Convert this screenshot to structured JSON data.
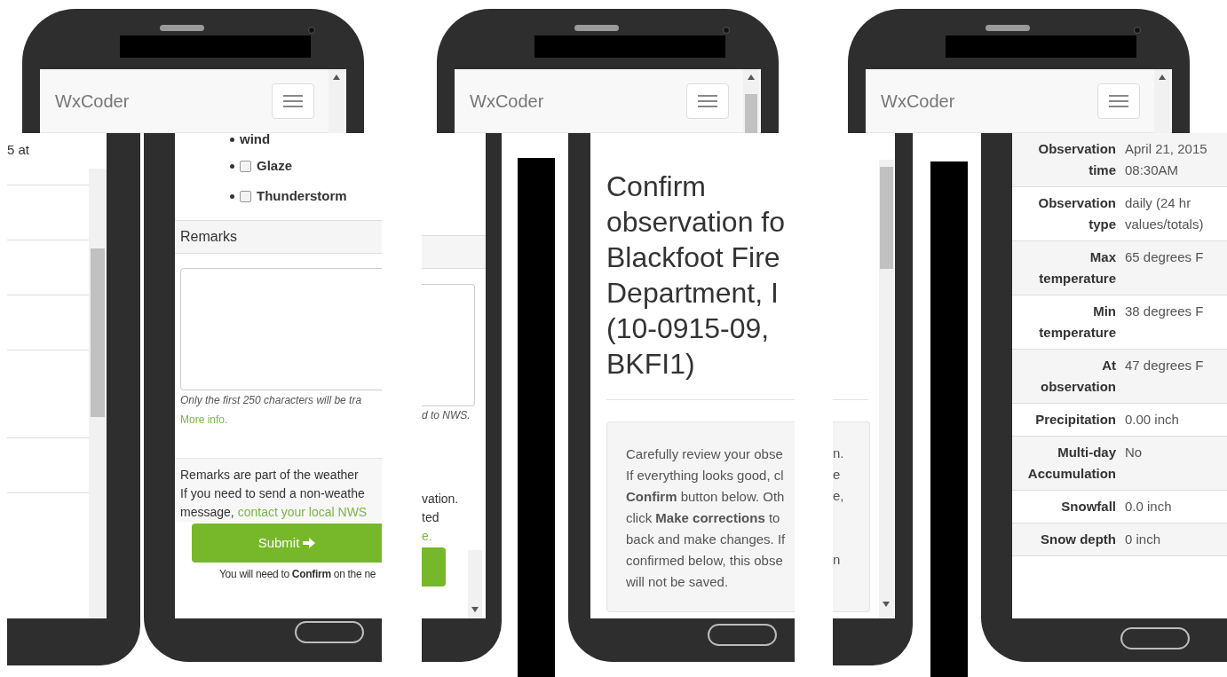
{
  "phones": [
    {
      "brand": "WxCoder"
    },
    {
      "brand": "WxCoder"
    },
    {
      "brand": "WxCoder"
    }
  ],
  "fragment_left": {
    "text": "5 at"
  },
  "remarks_screen": {
    "partial_item": "wind",
    "checkboxes": [
      {
        "label": "Glaze",
        "checked": false
      },
      {
        "label": "Thunderstorm",
        "checked": false
      }
    ],
    "section_title": "Remarks",
    "note": "Only the first 250 characters will be tra",
    "more_link": "More info.",
    "info_lines": [
      "Remarks are part of the weather",
      "If you need to send a non-weathe"
    ],
    "info_last": "message,",
    "info_link": "contact your local NWS",
    "submit": "Submit",
    "confirm_note": "You will need to **Confirm** on the ne"
  },
  "fragment_middle": {
    "lines": [
      {
        "kind": "note",
        "text": "d to NWS."
      },
      {
        "kind": "text",
        "text": "vation."
      },
      {
        "kind": "text",
        "text": "ted"
      },
      {
        "kind": "link",
        "text": "e."
      }
    ]
  },
  "confirm_screen": {
    "heading_lines": [
      "Confirm",
      "observation fo",
      "Blackfoot Fire",
      "Department, I",
      "(10-0915-09,",
      "BKFI1)"
    ],
    "info_lines": [
      "Carefully review your obse",
      "If everything looks good, cl",
      "**Confirm** button below. Oth",
      "click **Make corrections** to",
      "back and make changes. If",
      "confirmed below, this obse",
      "will not be saved."
    ]
  },
  "fragment_right": {
    "lines": [
      "n.",
      "e",
      "e,",
      "n"
    ]
  },
  "summary_table": {
    "rows": [
      {
        "label": [
          "Observation",
          "time"
        ],
        "value": [
          "April 21, 2015",
          "08:30AM"
        ]
      },
      {
        "label": [
          "Observation",
          "type"
        ],
        "value": [
          "daily (24 hr",
          "values/totals)"
        ]
      },
      {
        "label": [
          "Max",
          "temperature"
        ],
        "value": [
          "65 degrees F"
        ]
      },
      {
        "label": [
          "Min",
          "temperature"
        ],
        "value": [
          "38 degrees F"
        ]
      },
      {
        "label": [
          "At",
          "observation"
        ],
        "value": [
          "47 degrees F"
        ]
      },
      {
        "label": [
          "Precipitation"
        ],
        "value": [
          "0.00 inch"
        ]
      },
      {
        "label": [
          "Multi-day",
          "Accumulation"
        ],
        "value": [
          "No"
        ]
      },
      {
        "label": [
          "Snowfall"
        ],
        "value": [
          "0.0 inch"
        ]
      },
      {
        "label": [
          "Snow depth"
        ],
        "value": [
          "0 inch"
        ]
      }
    ]
  }
}
